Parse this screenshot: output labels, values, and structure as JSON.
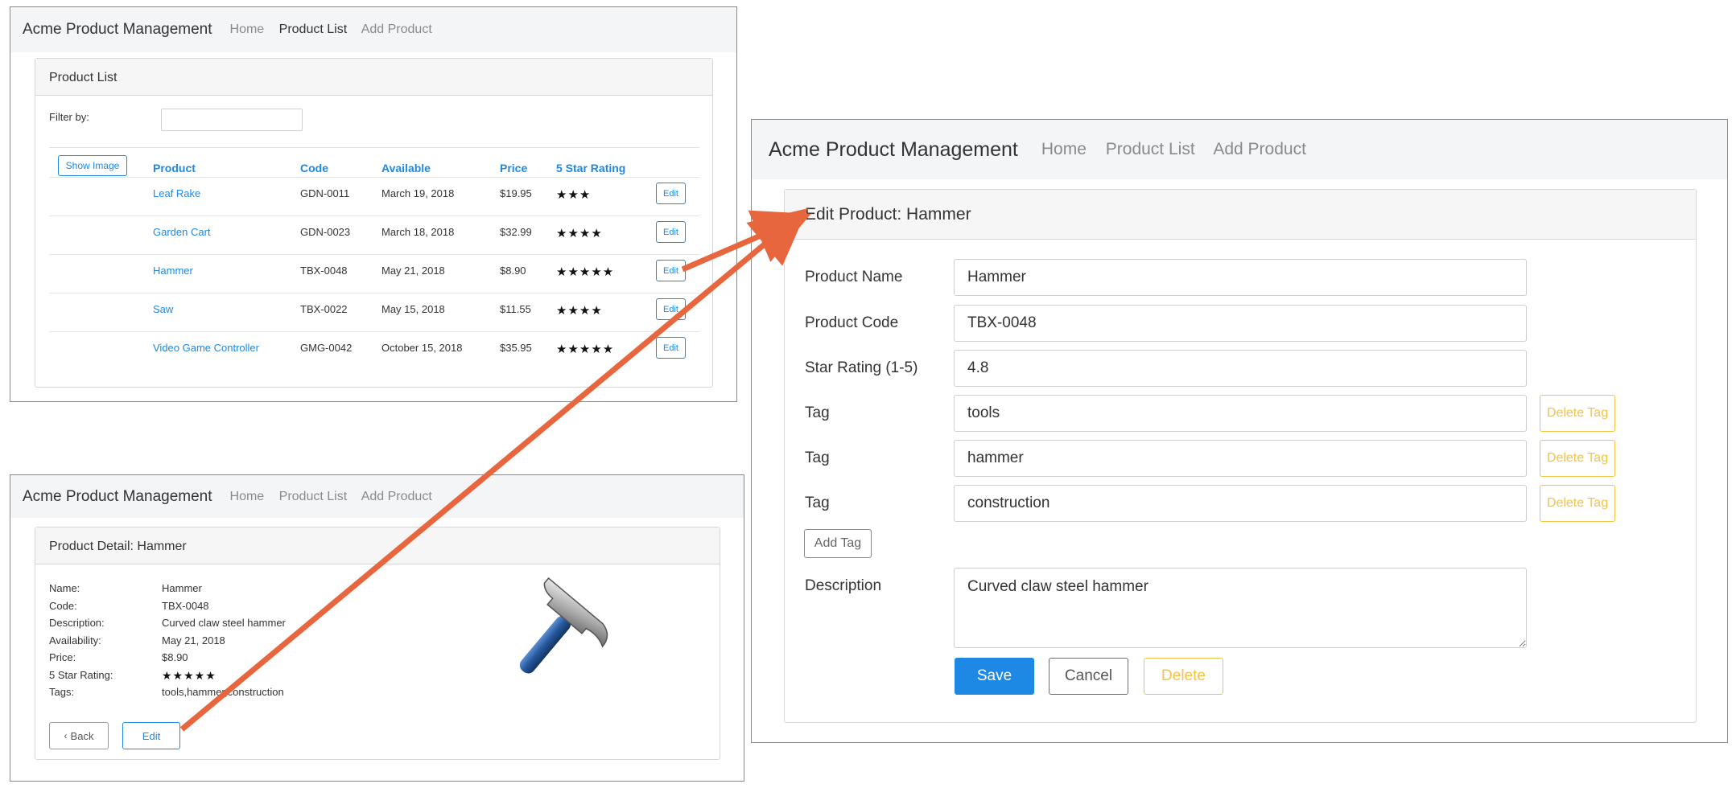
{
  "app": {
    "brand": "Acme Product Management",
    "nav": {
      "home": "Home",
      "product_list": "Product List",
      "add_product": "Add Product"
    }
  },
  "list_page": {
    "title": "Product List",
    "filter_label": "Filter by:",
    "filter_value": "",
    "show_image_label": "Show Image",
    "columns": {
      "product": "Product",
      "code": "Code",
      "available": "Available",
      "price": "Price",
      "rating": "5 Star Rating"
    },
    "edit_label": "Edit",
    "rows": [
      {
        "name": "Leaf Rake",
        "code": "GDN-0011",
        "available": "March 19, 2018",
        "price": "$19.95",
        "stars": "★★★",
        "rating": 3.2
      },
      {
        "name": "Garden Cart",
        "code": "GDN-0023",
        "available": "March 18, 2018",
        "price": "$32.99",
        "stars": "★★★★",
        "rating": 4.2
      },
      {
        "name": "Hammer",
        "code": "TBX-0048",
        "available": "May 21, 2018",
        "price": "$8.90",
        "stars": "★★★★★",
        "rating": 4.8
      },
      {
        "name": "Saw",
        "code": "TBX-0022",
        "available": "May 15, 2018",
        "price": "$11.55",
        "stars": "★★★★",
        "rating": 3.7
      },
      {
        "name": "Video Game Controller",
        "code": "GMG-0042",
        "available": "October 15, 2018",
        "price": "$35.95",
        "stars": "★★★★★",
        "rating": 4.6
      }
    ]
  },
  "detail_page": {
    "title": "Product Detail: Hammer",
    "fields": [
      {
        "label": "Name:",
        "value": "Hammer"
      },
      {
        "label": "Code:",
        "value": "TBX-0048"
      },
      {
        "label": "Description:",
        "value": "Curved claw steel hammer"
      },
      {
        "label": "Availability:",
        "value": "May 21, 2018"
      },
      {
        "label": "Price:",
        "value": "$8.90"
      },
      {
        "label": "5 Star Rating:",
        "value": "★★★★★"
      },
      {
        "label": "Tags:",
        "value": "tools,hammer,construction"
      }
    ],
    "back_label": "Back",
    "edit_label": "Edit"
  },
  "edit_page": {
    "title": "Edit Product: Hammer",
    "product_name": {
      "label": "Product Name",
      "value": "Hammer"
    },
    "product_code": {
      "label": "Product Code",
      "value": "TBX-0048"
    },
    "star_rating": {
      "label": "Star Rating (1-5)",
      "value": "4.8"
    },
    "tags": [
      {
        "label": "Tag",
        "value": "tools",
        "delete_label": "Delete Tag"
      },
      {
        "label": "Tag",
        "value": "hammer",
        "delete_label": "Delete Tag"
      },
      {
        "label": "Tag",
        "value": "construction",
        "delete_label": "Delete Tag"
      }
    ],
    "add_tag_label": "Add Tag",
    "description": {
      "label": "Description",
      "value": "Curved claw steel hammer"
    },
    "save_label": "Save",
    "cancel_label": "Cancel",
    "delete_label": "Delete"
  },
  "colors": {
    "link": "#1e88e5",
    "primary": "#1e88e5",
    "warning": "#f5c344",
    "arrow": "#e8663d"
  },
  "icons": {
    "back": "chevron-left-icon",
    "product_image": "hammer-icon"
  }
}
